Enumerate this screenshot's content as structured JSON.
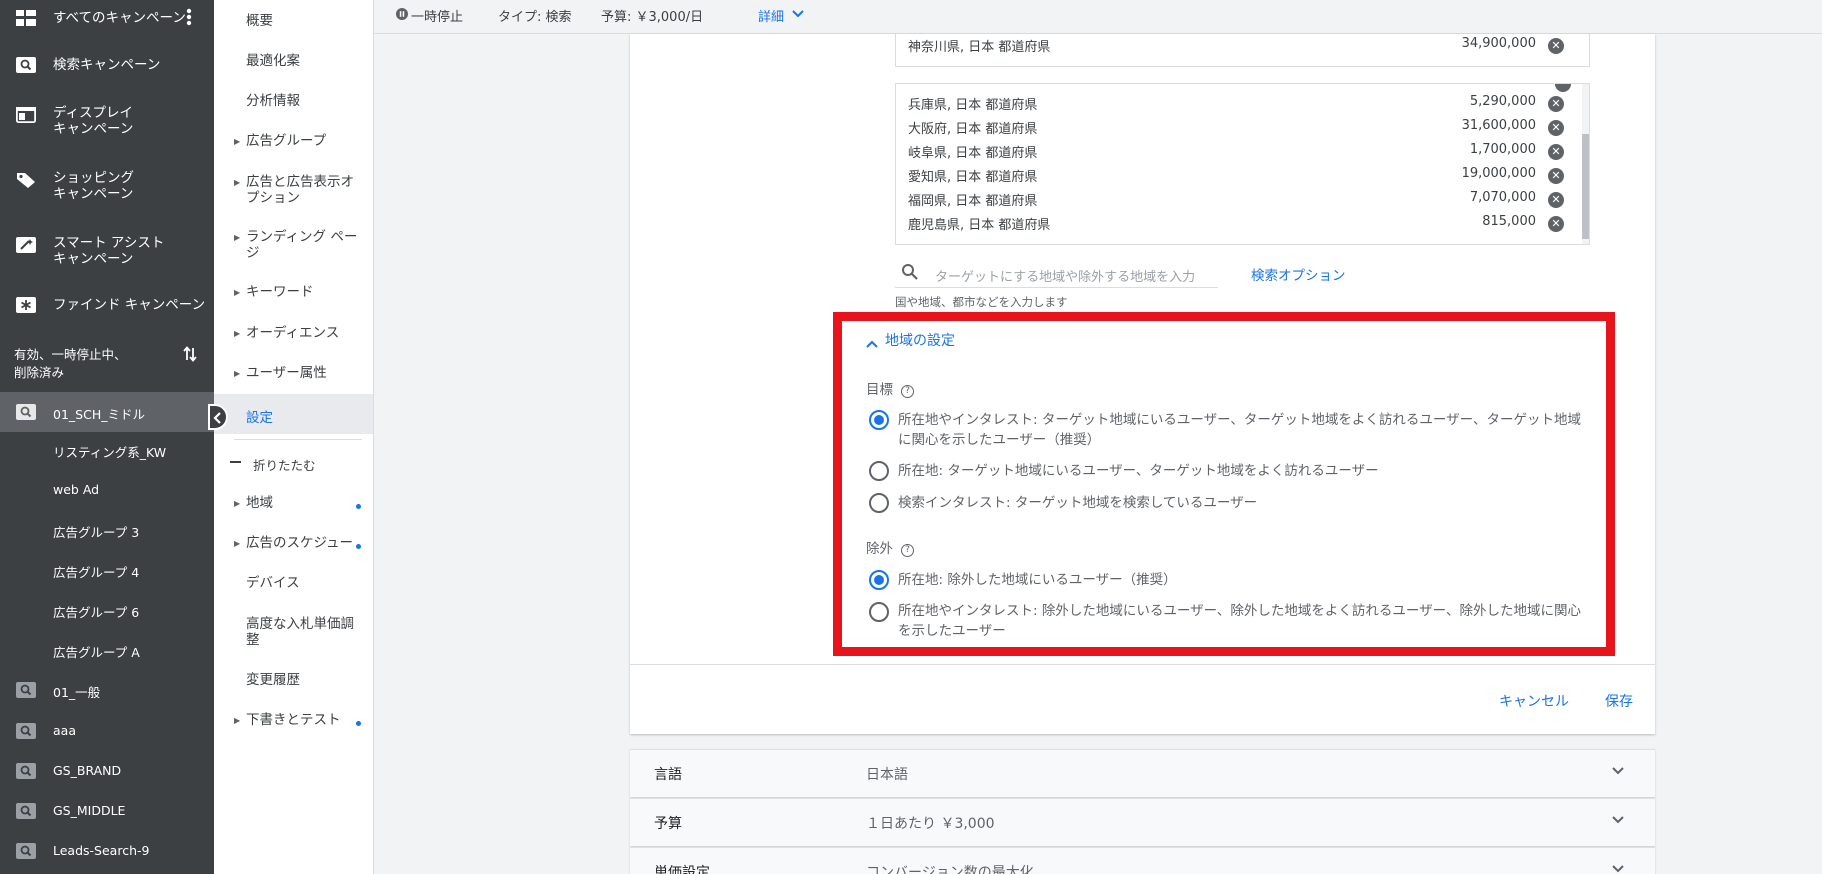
{
  "left_nav": {
    "all_campaigns": "すべてのキャンペーン",
    "items": [
      {
        "label": "検索キャンペーン"
      },
      {
        "label": "ディスプレイ\nキャンペーン"
      },
      {
        "label": "ショッピング\nキャンペーン"
      },
      {
        "label": "スマート アシスト\nキャンペーン"
      },
      {
        "label": "ファインド キャンペーン"
      }
    ],
    "filter_label": "有効、一時停止中、\n削除済み",
    "campaigns": [
      {
        "label": "01_SCH_ミドル"
      },
      {
        "label": "リスティング系_KW"
      },
      {
        "label": "web Ad"
      },
      {
        "label": "広告グループ 3"
      },
      {
        "label": "広告グループ 4"
      },
      {
        "label": "広告グループ 6"
      },
      {
        "label": "広告グループ A"
      },
      {
        "label": "01_一般"
      },
      {
        "label": "aaa"
      },
      {
        "label": "GS_BRAND"
      },
      {
        "label": "GS_MIDDLE"
      },
      {
        "label": "Leads-Search-9"
      }
    ]
  },
  "sec_nav": {
    "items": [
      {
        "label": "概要"
      },
      {
        "label": "最適化案"
      },
      {
        "label": "分析情報"
      },
      {
        "label": "広告グループ"
      },
      {
        "label": "広告と広告表示オ\nプション"
      },
      {
        "label": "ランディング ペー\nジ"
      },
      {
        "label": "キーワード"
      },
      {
        "label": "オーディエンス"
      },
      {
        "label": "ユーザー属性"
      },
      {
        "label": "設定"
      }
    ],
    "collapse": "折りたたむ",
    "items2": [
      {
        "label": "地域"
      },
      {
        "label": "広告のスケジュール"
      },
      {
        "label": "デバイス"
      },
      {
        "label": "高度な入札単価調\n整"
      },
      {
        "label": "変更履歴"
      },
      {
        "label": "下書きとテスト"
      }
    ]
  },
  "top_bar": {
    "status": "一時停止",
    "type": "タイプ: 検索",
    "budget": "予算: ￥3,000/日",
    "details": "詳細"
  },
  "locations": {
    "top": {
      "name": "神奈川県, 日本 都道府県",
      "value": "34,900,000"
    },
    "list": [
      {
        "name": "兵庫県, 日本 都道府県",
        "value": "5,290,000"
      },
      {
        "name": "大阪府, 日本 都道府県",
        "value": "31,600,000"
      },
      {
        "name": "岐阜県, 日本 都道府県",
        "value": "1,700,000"
      },
      {
        "name": "愛知県, 日本 都道府県",
        "value": "19,000,000"
      },
      {
        "name": "福岡県, 日本 都道府県",
        "value": "7,070,000"
      },
      {
        "name": "鹿児島県, 日本 都道府県",
        "value": "815,000"
      }
    ],
    "search_placeholder": "ターゲットにする地域や除外する地域を入力",
    "search_options": "検索オプション",
    "hint": "国や地域、都市などを入力します"
  },
  "location_settings": {
    "title": "地域の設定",
    "target_label": "目標",
    "target_options": [
      {
        "text": "所在地やインタレスト: ターゲット地域にいるユーザー、ターゲット地域をよく訪れるユーザー、ターゲット地域に関心を示したユーザー（推奨）",
        "selected": true
      },
      {
        "text": "所在地: ターゲット地域にいるユーザー、ターゲット地域をよく訪れるユーザー",
        "selected": false
      },
      {
        "text": "検索インタレスト: ターゲット地域を検索しているユーザー",
        "selected": false
      }
    ],
    "exclude_label": "除外",
    "exclude_options": [
      {
        "text": "所在地: 除外した地域にいるユーザー（推奨）",
        "selected": true
      },
      {
        "text": "所在地やインタレスト: 除外した地域にいるユーザー、除外した地域をよく訪れるユーザー、除外した地域に関心を示したユーザー",
        "selected": false
      }
    ]
  },
  "actions": {
    "cancel": "キャンセル",
    "save": "保存"
  },
  "sections": [
    {
      "title": "言語",
      "value": "日本語"
    },
    {
      "title": "予算",
      "value": "１日あたり ￥3,000"
    },
    {
      "title": "単価設定",
      "value": "コンバージョン数の最大化"
    }
  ],
  "colors": {
    "accent": "#1a73e8",
    "highlight": "#e8141c",
    "sidebar": "#3c4043"
  }
}
